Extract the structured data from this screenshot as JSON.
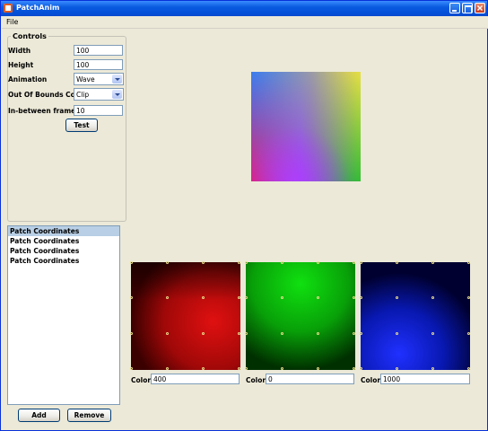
{
  "window": {
    "title": "PatchAnim"
  },
  "menu": {
    "file": "File"
  },
  "controls": {
    "legend": "Controls",
    "width_label": "Width",
    "width_value": "100",
    "height_label": "Height",
    "height_value": "100",
    "animation_label": "Animation",
    "animation_value": "Wave",
    "oob_label": "Out Of Bounds Color",
    "oob_value": "Clip",
    "frames_label": "In-between frames",
    "frames_value": "10",
    "test_button": "Test"
  },
  "list": {
    "items": [
      "Patch Coordinates",
      "Patch Coordinates",
      "Patch Coordinates",
      "Patch Coordinates"
    ]
  },
  "buttons": {
    "add": "Add",
    "remove": "Remove"
  },
  "patches": [
    {
      "color_label": "Color",
      "color_value": "400",
      "hue": "red"
    },
    {
      "color_label": "Color",
      "color_value": "0",
      "hue": "green"
    },
    {
      "color_label": "Color",
      "color_value": "1000",
      "hue": "blue"
    }
  ],
  "colors": {
    "titlebar": "#0A5BE0",
    "selection": "#B8CFE5",
    "control_point": "#E8DD8A"
  }
}
